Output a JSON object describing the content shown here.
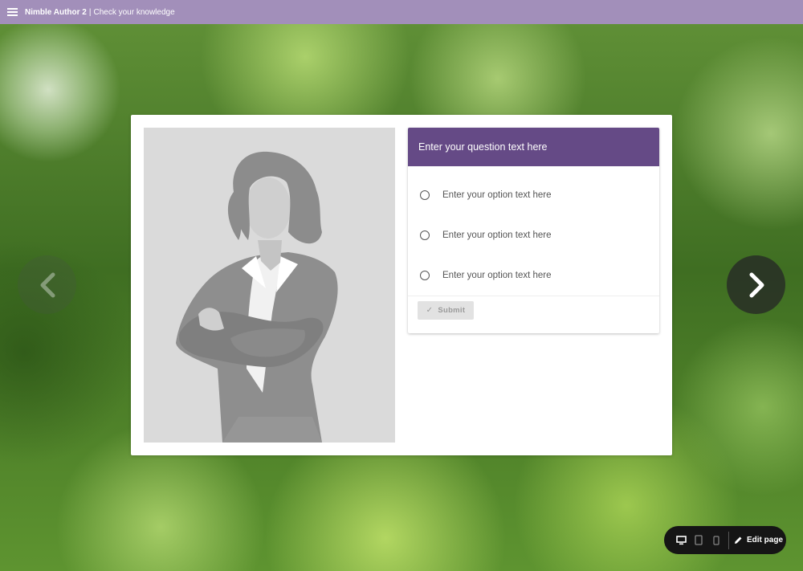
{
  "header": {
    "app_name": "Nimble Author 2",
    "separator": "|",
    "page_title": "Check your knowledge",
    "color": "#a28fba"
  },
  "question": {
    "text": "Enter your question text here",
    "header_color": "#654a86",
    "options": [
      {
        "label": "Enter your option text here"
      },
      {
        "label": "Enter your option text here"
      },
      {
        "label": "Enter your option text here"
      }
    ],
    "submit_label": "Submit"
  },
  "navigation": {
    "prev_icon": "chevron-left-icon",
    "next_icon": "chevron-right-icon"
  },
  "toolbar": {
    "device_icons": [
      "desktop-icon",
      "tablet-icon",
      "phone-icon"
    ],
    "edit_label": "Edit page"
  }
}
